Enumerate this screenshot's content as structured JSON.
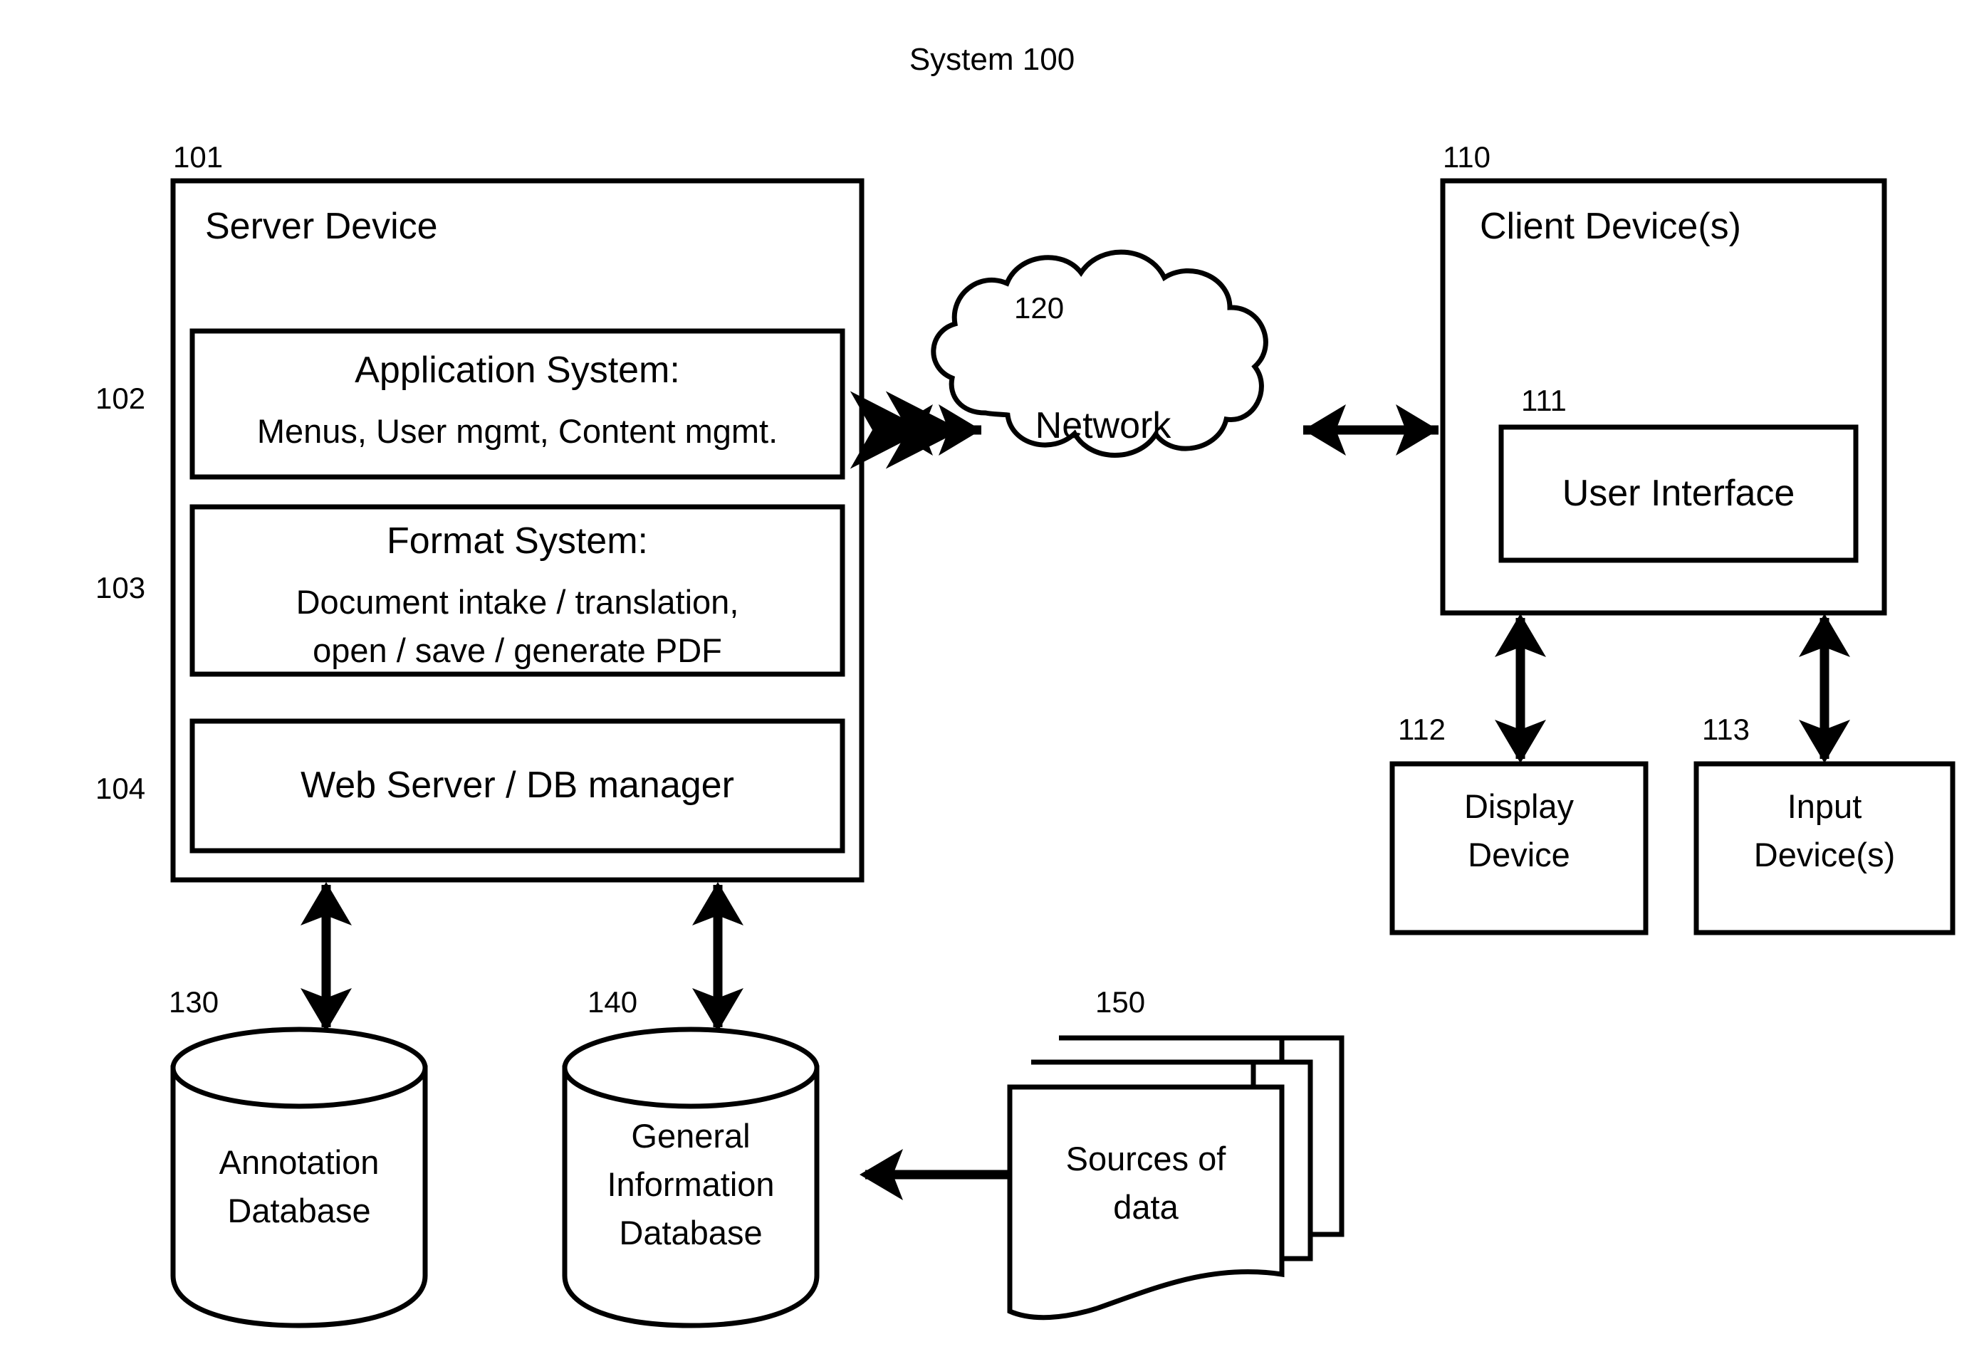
{
  "figure": {
    "title": "System 100"
  },
  "server": {
    "ref": "101",
    "label": "Server Device",
    "modules": [
      {
        "ref": "102",
        "title": "Application System:",
        "detail": "Menus, User mgmt, Content mgmt."
      },
      {
        "ref": "103",
        "title": "Format System:",
        "detail_line1": "Document intake / translation,",
        "detail_line2": "open / save / generate PDF"
      },
      {
        "ref": "104",
        "title": "Web Server / DB manager"
      }
    ]
  },
  "network": {
    "ref": "120",
    "label": "Network"
  },
  "client": {
    "ref": "110",
    "label": "Client Device(s)",
    "user_interface": {
      "ref": "111",
      "label": "User Interface"
    },
    "display_device": {
      "ref": "112",
      "line1": "Display",
      "line2": "Device"
    },
    "input_device": {
      "ref": "113",
      "line1": "Input",
      "line2": "Device(s)"
    }
  },
  "stores": {
    "annotation_db": {
      "ref": "130",
      "line1": "Annotation",
      "line2": "Database"
    },
    "general_db": {
      "ref": "140",
      "line1": "General",
      "line2": "Information",
      "line3": "Database"
    },
    "sources": {
      "ref": "150",
      "line1": "Sources of",
      "line2": "data"
    }
  },
  "colors": {
    "ink": "#000000",
    "paper": "#ffffff"
  }
}
